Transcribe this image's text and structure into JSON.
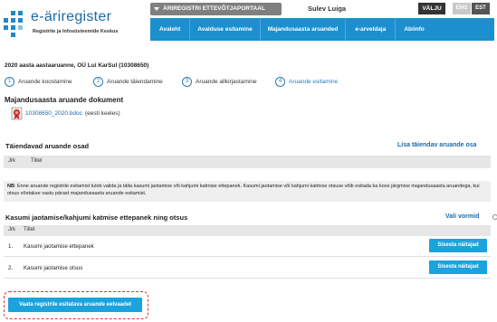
{
  "header": {
    "logo_title": "e-äriregister",
    "logo_subtitle": "Registrite ja Infosüsteemide Keskus",
    "portal_select": "ÄRIREGISTRI ETTEVÕTJAPORTAAL",
    "username": "Sulev Luiga",
    "logout_label": "VÄLJU",
    "languages": [
      "ENG",
      "EST"
    ],
    "active_language": "EST",
    "brand_color": "#1c8fcf"
  },
  "nav": {
    "items": [
      "Avaleht",
      "Avalduse esitamine",
      "Majandusaasta aruanded",
      "e-arveldaja",
      "Abiinfo"
    ]
  },
  "main": {
    "company_title": "2020 aasta aastaaruanne,   OÜ Lui KarSul (10308650)",
    "steps": [
      {
        "num": "1",
        "label": "Aruande koostamine"
      },
      {
        "num": "2",
        "label": "Aruande täiendamine"
      },
      {
        "num": "3",
        "label": "Aruande allkirjastamine"
      },
      {
        "num": "4",
        "label": "Aruande esitamine"
      }
    ],
    "active_step": "4",
    "document_section_title": "Majandusaasta aruande dokument",
    "document_file": "10308650_2020.bdoc",
    "document_note": "(eesti keeles)",
    "supplementary": {
      "title": "Täiendavad aruande osad",
      "add_link": "Lisa täiendav aruande osa",
      "col_nr": "Jrk",
      "col_title": "Tiitel"
    },
    "nb_label": "NB",
    "nb_text": ": Enne aruande registrile esitamist tuleb valida ja täita kasumi jaotamise või kahjumi katmise ettepanek. Kasumi jaotamise või kahjumi katmise otsuse võib esitada ka koos järgmise majandusaasta aruandega, kui otsus võetakse vastu pärast majandusaasta aruande esitamist.",
    "profit": {
      "title": "Kasumi jaotamise/kahjumi katmise ettepanek ning otsus",
      "forms_link": "Vali vormid",
      "col_nr": "Jrk",
      "col_title": "Tiitel",
      "rows": [
        {
          "num": "1.",
          "name": "Kasumi jaotamise ettepanek",
          "button": "Sisesta näitajad"
        },
        {
          "num": "2.",
          "name": "Kasumi jaotamise otsus",
          "button": "Sisesta näitajad"
        }
      ]
    },
    "preview_button": "Vaata registrile esitatava aruande eelvaadet"
  }
}
